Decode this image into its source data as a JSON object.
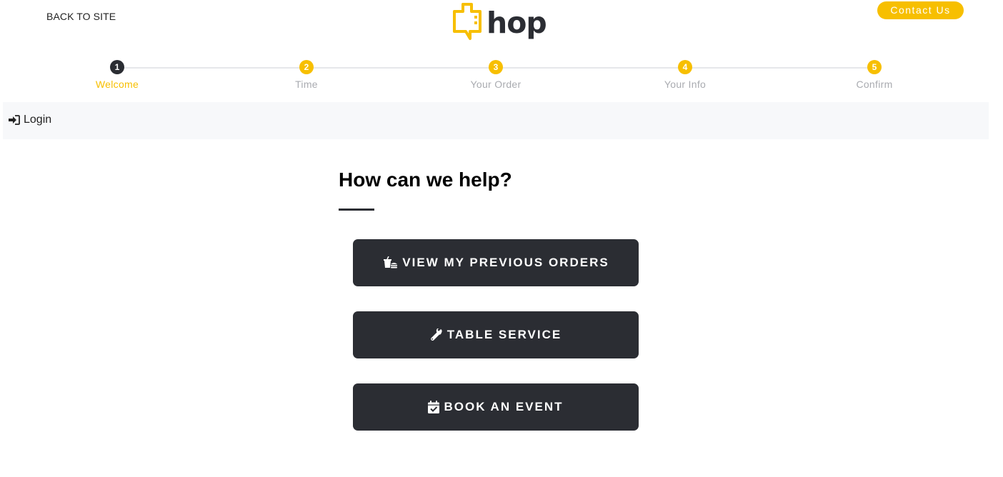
{
  "header": {
    "back_link": "BACK TO SITE",
    "logo_text": "hop",
    "contact_label": "Contact Us"
  },
  "colors": {
    "brand_yellow": "#f7bf00",
    "dark": "#2b2d33",
    "muted_text": "#a9abb0",
    "login_bar_bg": "#f7f8fa"
  },
  "stepper": {
    "active_index": 0,
    "steps": [
      {
        "number": "1",
        "label": "Welcome"
      },
      {
        "number": "2",
        "label": "Time"
      },
      {
        "number": "3",
        "label": "Your Order"
      },
      {
        "number": "4",
        "label": "Your Info"
      },
      {
        "number": "5",
        "label": "Confirm"
      }
    ]
  },
  "login": {
    "label": "Login",
    "icon": "sign-in-icon"
  },
  "main": {
    "heading": "How can we help?",
    "actions": [
      {
        "label": "VIEW MY PREVIOUS ORDERS",
        "icon": "food-order-icon"
      },
      {
        "label": "TABLE SERVICE",
        "icon": "wrench-icon"
      },
      {
        "label": "BOOK AN EVENT",
        "icon": "calendar-check-icon"
      }
    ]
  }
}
